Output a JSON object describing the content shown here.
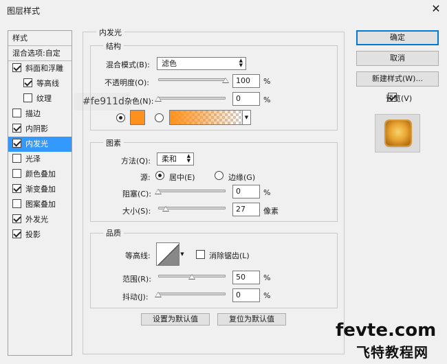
{
  "window": {
    "title": "图层样式",
    "close_glyph": "✕"
  },
  "style_list": {
    "header": "样式",
    "blend_options": "混合选项:自定",
    "items": [
      {
        "label": "斜面和浮雕",
        "checked": true,
        "indent": false,
        "selected": false
      },
      {
        "label": "等高线",
        "checked": true,
        "indent": true,
        "selected": false
      },
      {
        "label": "纹理",
        "checked": false,
        "indent": true,
        "selected": false
      },
      {
        "label": "描边",
        "checked": false,
        "indent": false,
        "selected": false
      },
      {
        "label": "内阴影",
        "checked": true,
        "indent": false,
        "selected": false
      },
      {
        "label": "内发光",
        "checked": true,
        "indent": false,
        "selected": true
      },
      {
        "label": "光泽",
        "checked": false,
        "indent": false,
        "selected": false
      },
      {
        "label": "颜色叠加",
        "checked": false,
        "indent": false,
        "selected": false
      },
      {
        "label": "渐变叠加",
        "checked": true,
        "indent": false,
        "selected": false
      },
      {
        "label": "图案叠加",
        "checked": false,
        "indent": false,
        "selected": false
      },
      {
        "label": "外发光",
        "checked": true,
        "indent": false,
        "selected": false
      },
      {
        "label": "投影",
        "checked": true,
        "indent": false,
        "selected": false
      }
    ]
  },
  "panel": {
    "title": "内发光",
    "structure": {
      "title": "结构",
      "blend_mode_label": "混合模式(B):",
      "blend_mode_value": "滤色",
      "opacity_label": "不透明度(O):",
      "opacity_value": "100",
      "opacity_level": 1.0,
      "noise_label": "杂色(N):",
      "noise_value": "0",
      "noise_level": 0,
      "percent": "%",
      "color": "#fe911d",
      "color_radio_selected": true,
      "gradient_radio_selected": false
    },
    "elements": {
      "title": "图素",
      "technique_label": "方法(Q):",
      "technique_value": "柔和",
      "source_label": "源:",
      "source_center": "居中(E)",
      "source_edge": "边缘(G)",
      "source_center_selected": true,
      "choke_label": "阻塞(C):",
      "choke_value": "0",
      "choke_level": 0,
      "size_label": "大小(S):",
      "size_value": "27",
      "size_level": 0.11,
      "size_unit": "像素",
      "percent": "%"
    },
    "quality": {
      "title": "品质",
      "contour_label": "等高线:",
      "antialias_label": "消除锯齿(L)",
      "antialias_checked": false,
      "range_label": "范围(R):",
      "range_value": "50",
      "range_level": 0.5,
      "jitter_label": "抖动(J):",
      "jitter_value": "0",
      "jitter_level": 0,
      "percent": "%"
    },
    "buttons": {
      "set_default": "设置为默认值",
      "reset_default": "复位为默认值"
    }
  },
  "right": {
    "ok": "确定",
    "cancel": "取消",
    "new_style": "新建样式(W)...",
    "preview_label": "预览(V)",
    "preview_checked": true
  },
  "tooltip": "#fe911d",
  "watermark": {
    "line1": "fevte.com",
    "line2": "飞特教程网"
  }
}
